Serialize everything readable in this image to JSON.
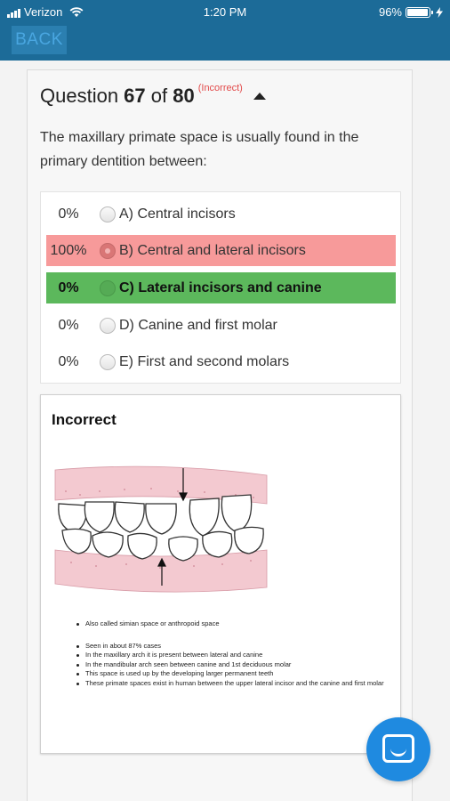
{
  "status_bar": {
    "carrier": "Verizon",
    "time": "1:20 PM",
    "battery_percent": "96%"
  },
  "nav": {
    "back_label": "BACK"
  },
  "question": {
    "prefix": "Question ",
    "number": "67",
    "of_text": " of ",
    "total": "80",
    "status": "(Incorrect)",
    "text": "The maxillary primate space is usually found in the primary dentition between:"
  },
  "options": [
    {
      "percent": "0%",
      "label": "A) Central incisors",
      "state": "none"
    },
    {
      "percent": "100%",
      "label": "B) Central and lateral incisors",
      "state": "selected-wrong"
    },
    {
      "percent": "0%",
      "label": "C) Lateral incisors and canine",
      "state": "correct"
    },
    {
      "percent": "0%",
      "label": "D) Canine and first molar",
      "state": "none"
    },
    {
      "percent": "0%",
      "label": "E) First and second molars",
      "state": "none"
    }
  ],
  "feedback": {
    "title": "Incorrect",
    "bullets": [
      "Also called simian space or anthropoid space",
      "Seen in about 87% cases",
      "In the maxillary arch it is present between lateral and canine",
      "In the mandibular arch seen between canine and 1st deciduous molar",
      "This space is used up by the developing larger permanent teeth",
      "These primate spaces exist in human between the upper lateral incisor and the canine and first molar"
    ]
  },
  "colors": {
    "header_blue": "#1c6b98",
    "back_text": "#49a6e0",
    "wrong_row": "#f79a9a",
    "correct_row": "#5cb85c",
    "incorrect_label": "#e24a4a",
    "chat_button": "#1f8ae0"
  },
  "icons": {
    "signal": "signal-bars-icon",
    "wifi": "wifi-icon",
    "battery": "battery-icon",
    "charging": "bolt-icon",
    "collapse": "caret-up-icon",
    "chat": "chat-bubble-icon"
  }
}
